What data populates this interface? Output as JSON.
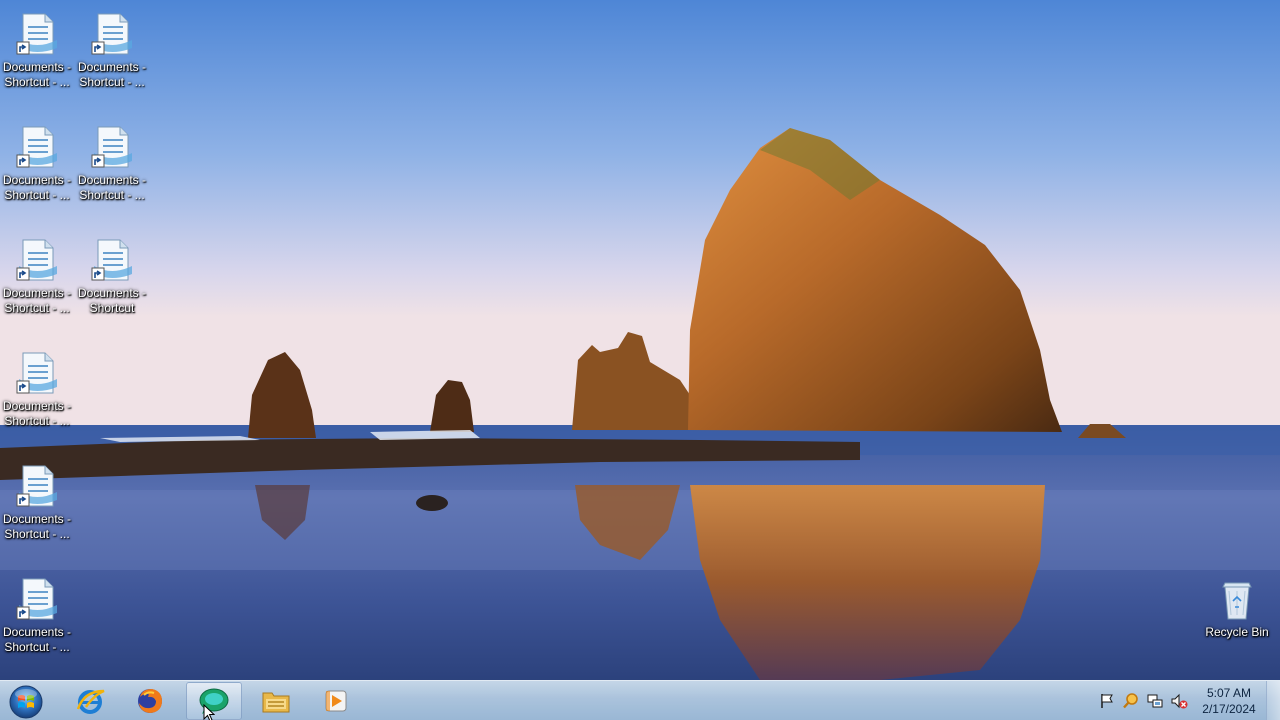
{
  "desktop": {
    "icons": [
      {
        "line1": "Documents -",
        "line2": "Shortcut - ..."
      },
      {
        "line1": "Documents -",
        "line2": "Shortcut - ..."
      },
      {
        "line1": "Documents -",
        "line2": "Shortcut - ..."
      },
      {
        "line1": "Documents -",
        "line2": "Shortcut - ..."
      },
      {
        "line1": "Documents -",
        "line2": "Shortcut - ..."
      },
      {
        "line1": "Documents -",
        "line2": "Shortcut"
      },
      {
        "line1": "Documents -",
        "line2": "Shortcut - ..."
      },
      {
        "line1": "Documents -",
        "line2": "Shortcut - ..."
      },
      {
        "line1": "Documents -",
        "line2": "Shortcut - ..."
      }
    ],
    "recycle_bin": {
      "label": "Recycle Bin"
    }
  },
  "taskbar": {
    "pinned": [
      {
        "name": "start-button",
        "icon": "windows-logo-icon"
      },
      {
        "name": "internet-explorer",
        "icon": "internet-explorer-icon"
      },
      {
        "name": "firefox",
        "icon": "firefox-icon"
      },
      {
        "name": "chat-app",
        "icon": "chat-bubble-icon",
        "active": true
      },
      {
        "name": "file-explorer",
        "icon": "folder-icon"
      },
      {
        "name": "media-player",
        "icon": "media-player-icon"
      }
    ],
    "tray": {
      "icons": [
        "action-center-flag-icon",
        "search-magnifier-icon",
        "network-icon",
        "volume-muted-icon"
      ]
    },
    "clock": {
      "time": "5:07 AM",
      "date": "2/17/2024"
    }
  },
  "colors": {
    "sky_top": "#5a8fd8",
    "sky_bottom": "#e9e1ec",
    "rock": "#b86a2a",
    "water": "#2f4d8f",
    "taskbar": "#bcd2e8",
    "label_text": "#ffffff"
  }
}
